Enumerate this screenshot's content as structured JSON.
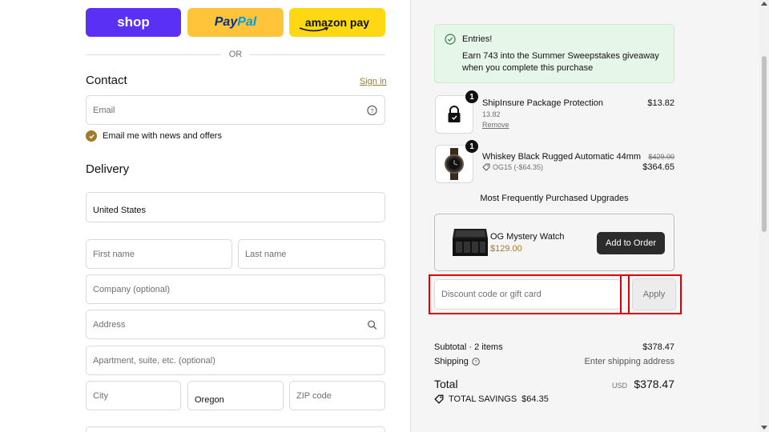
{
  "express": {
    "shop_label": "shop",
    "paypal_pay": "Pay",
    "paypal_pal": "Pal",
    "amazon_label": "amazon pay",
    "or_label": "OR"
  },
  "contact": {
    "heading": "Contact",
    "signin_link": "Sign in",
    "email_placeholder": "Email",
    "news_label": "Email me with news and offers"
  },
  "delivery": {
    "heading": "Delivery",
    "country_value": "United States",
    "first_name_placeholder": "First name",
    "last_name_placeholder": "Last name",
    "company_placeholder": "Company (optional)",
    "address_placeholder": "Address",
    "apartment_placeholder": "Apartment, suite, etc. (optional)",
    "city_placeholder": "City",
    "state_value": "Oregon",
    "zip_placeholder": "ZIP code"
  },
  "summary": {
    "entries_title": "Entries!",
    "entries_text": "Earn 743 into the Summer Sweepstakes giveaway when you complete this purchase",
    "items": [
      {
        "qty": "1",
        "name": "ShipInsure Package Protection",
        "sub": "13.82",
        "remove_label": "Remove",
        "price": "$13.82",
        "icon": "lock-icon"
      },
      {
        "qty": "1",
        "name": "Whiskey Black Rugged Automatic 44mm",
        "discount": "OG15 (-$64.35)",
        "original_price": "$429.00",
        "price": "$364.65",
        "icon": "watch-icon"
      }
    ],
    "upgrades_title": "Most Frequently Purchased Upgrades",
    "upgrade": {
      "name": "OG Mystery Watch",
      "price": "$129.00",
      "button_label": "Add to Order"
    },
    "discount_placeholder": "Discount code or gift card",
    "apply_label": "Apply",
    "subtotal_label": "Subtotal · 2 items",
    "subtotal_value": "$378.47",
    "shipping_label": "Shipping",
    "shipping_value": "Enter shipping address",
    "total_label": "Total",
    "total_currency": "USD",
    "total_value": "$378.47",
    "savings_label": "TOTAL SAVINGS",
    "savings_value": "$64.35"
  },
  "colors": {
    "shop": "#5a31f4",
    "paypal": "#ffc439",
    "amazon": "#ffd814",
    "accent": "#a17a2c",
    "success_bg": "#e6f7e9",
    "highlight": "#e00000"
  }
}
